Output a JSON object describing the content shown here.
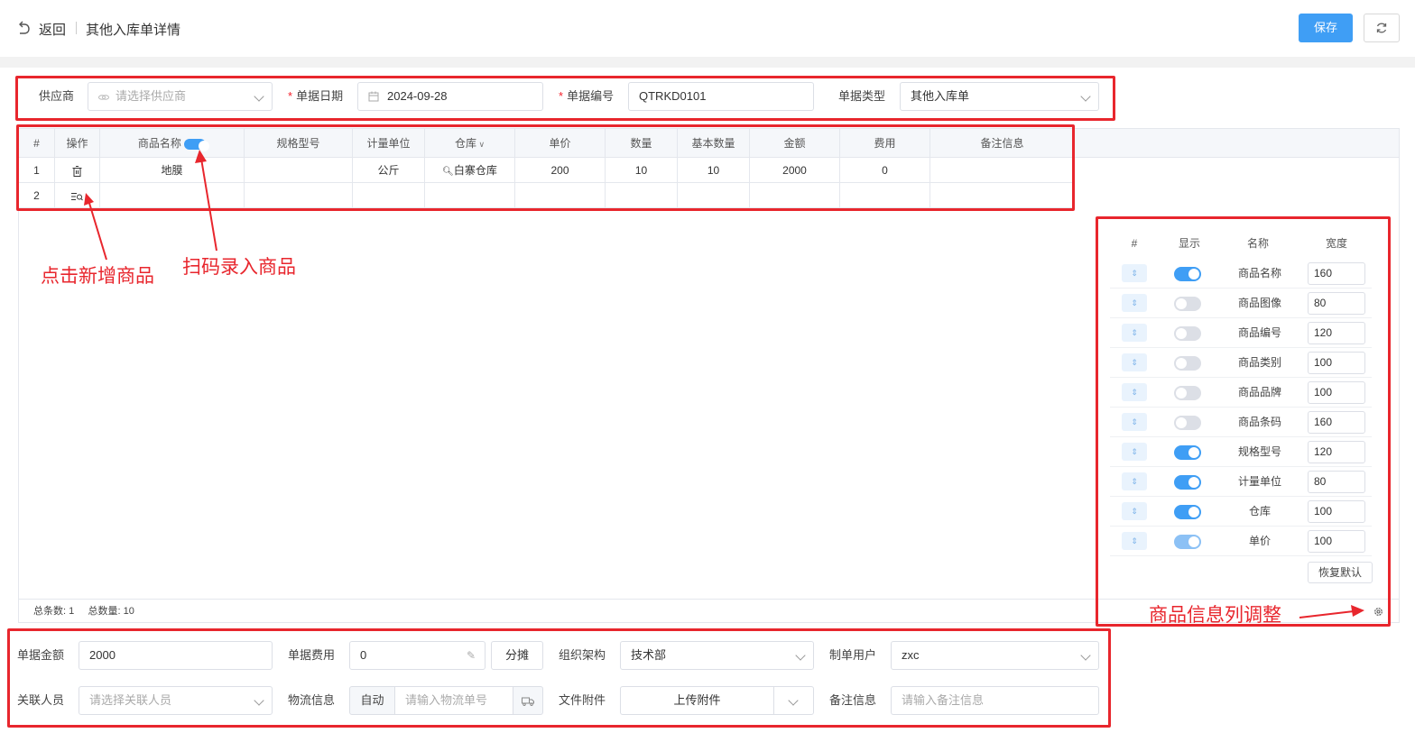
{
  "header": {
    "back_label": "返回",
    "title": "其他入库单详情",
    "save_label": "保存"
  },
  "form": {
    "supplier_label": "供应商",
    "supplier_placeholder": "请选择供应商",
    "date_label": "单据日期",
    "date_value": "2024-09-28",
    "number_label": "单据编号",
    "number_value": "QTRKD0101",
    "type_label": "单据类型",
    "type_value": "其他入库单"
  },
  "table": {
    "headers": [
      "#",
      "操作",
      "商品名称",
      "规格型号",
      "计量单位",
      "仓库",
      "单价",
      "数量",
      "基本数量",
      "金额",
      "费用",
      "备注信息"
    ],
    "rows": [
      {
        "index": "1",
        "name": "地膜",
        "spec": "",
        "unit": "公斤",
        "warehouse": "白寨仓库",
        "price": "200",
        "qty": "10",
        "base_qty": "10",
        "amount": "2000",
        "fee": "0",
        "remark": ""
      },
      {
        "index": "2",
        "name": "",
        "spec": "",
        "unit": "",
        "warehouse": "",
        "price": "",
        "qty": "",
        "base_qty": "",
        "amount": "",
        "fee": "",
        "remark": ""
      }
    ],
    "total_count_label": "总条数:",
    "total_count": "1",
    "total_qty_label": "总数量:",
    "total_qty": "10"
  },
  "column_panel": {
    "headers": [
      "#",
      "显示",
      "名称",
      "宽度"
    ],
    "columns": [
      {
        "name": "商品名称",
        "shown": true,
        "width": "160"
      },
      {
        "name": "商品图像",
        "shown": false,
        "width": "80"
      },
      {
        "name": "商品编号",
        "shown": false,
        "width": "120"
      },
      {
        "name": "商品类别",
        "shown": false,
        "width": "100"
      },
      {
        "name": "商品品牌",
        "shown": false,
        "width": "100"
      },
      {
        "name": "商品条码",
        "shown": false,
        "width": "160"
      },
      {
        "name": "规格型号",
        "shown": true,
        "width": "120"
      },
      {
        "name": "计量单位",
        "shown": true,
        "width": "80"
      },
      {
        "name": "仓库",
        "shown": true,
        "width": "100"
      },
      {
        "name": "单价",
        "shown": true,
        "width": "100"
      }
    ],
    "reset_label": "恢复默认"
  },
  "bottom_form": {
    "amount_label": "单据金额",
    "amount_value": "2000",
    "fee_label": "单据费用",
    "fee_value": "0",
    "split_label": "分摊",
    "org_label": "组织架构",
    "org_value": "技术部",
    "creator_label": "制单用户",
    "creator_value": "zxc",
    "related_label": "关联人员",
    "related_placeholder": "请选择关联人员",
    "logistics_label": "物流信息",
    "logistics_auto": "自动",
    "logistics_placeholder": "请输入物流单号",
    "attach_label": "文件附件",
    "attach_button": "上传附件",
    "remark_label": "备注信息",
    "remark_placeholder": "请输入备注信息"
  },
  "annotations": {
    "add_product": "点击新增商品",
    "scan_product": "扫码录入商品",
    "column_adjust": "商品信息列调整"
  },
  "colors": {
    "primary": "#3f9ef5",
    "annotation": "#e8262d"
  }
}
